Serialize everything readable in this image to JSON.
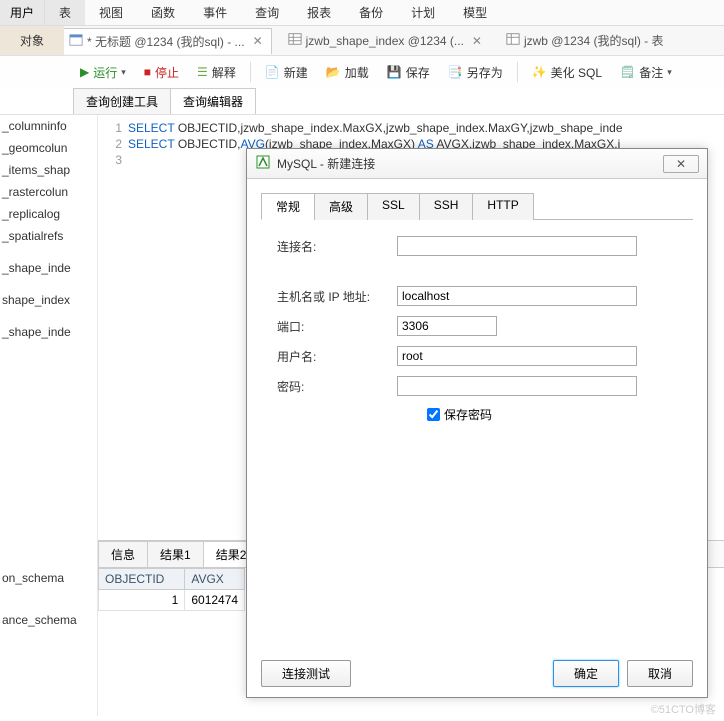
{
  "menubar": {
    "items": [
      "用户",
      "表",
      "视图",
      "函数",
      "事件",
      "查询",
      "报表",
      "备份",
      "计划",
      "模型"
    ],
    "active_index": 1
  },
  "top_tabs": {
    "left_label": "对象",
    "tabs": [
      {
        "icon": "sql",
        "label": "* 无标题 @1234 (我的sql) - ...",
        "closable": true,
        "active": true
      },
      {
        "icon": "table",
        "label": "jzwb_shape_index @1234 (...",
        "closable": true
      },
      {
        "icon": "table",
        "label": "jzwb @1234 (我的sql) - 表",
        "closable": false
      }
    ]
  },
  "toolbar": {
    "run": "运行",
    "stop": "停止",
    "explain": "解释",
    "new": "新建",
    "load": "加载",
    "save": "保存",
    "saveas": "另存为",
    "beautify": "美化 SQL",
    "notes": "备注"
  },
  "subtabs": {
    "items": [
      "查询创建工具",
      "查询编辑器"
    ],
    "active_index": 1
  },
  "sidebar": {
    "top": [
      "_columninfo",
      "_geomcolun",
      "_items_shap",
      "_rastercolun",
      "_replicalog",
      "_spatialrefs",
      "_shape_inde",
      "shape_index",
      "_shape_inde"
    ],
    "bottom": [
      "on_schema",
      "ance_schema"
    ]
  },
  "code": {
    "lines": [
      [
        {
          "t": "SELECT ",
          "k": true
        },
        {
          "t": "OBJECTID,jzwb_shape_index.MaxGX,jzwb_shape_index.MaxGY,jzwb_shape_inde"
        }
      ],
      [
        {
          "t": "SELECT ",
          "k": true
        },
        {
          "t": "OBJECTID,"
        },
        {
          "t": "AVG",
          "k": true
        },
        {
          "t": "(jzwb_shape_index.MaxGX) "
        },
        {
          "t": "AS ",
          "k": true
        },
        {
          "t": "AVGX,jzwb_shape_index.MaxGX,j"
        }
      ],
      []
    ]
  },
  "results": {
    "tabs": [
      "信息",
      "结果1",
      "结果2"
    ],
    "active_index": 2,
    "columns": [
      "OBJECTID",
      "AVGX"
    ],
    "row": [
      "1",
      "6012474"
    ]
  },
  "dialog": {
    "title": "MySQL - 新建连接",
    "close": "✕",
    "tabs": [
      "常规",
      "高级",
      "SSL",
      "SSH",
      "HTTP"
    ],
    "active_index": 0,
    "fields": {
      "conn_name_label": "连接名:",
      "conn_name": "",
      "host_label": "主机名或 IP 地址:",
      "host": "localhost",
      "port_label": "端口:",
      "port": "3306",
      "user_label": "用户名:",
      "user": "root",
      "pass_label": "密码:",
      "pass": "",
      "savepw_label": "保存密码",
      "savepw": true
    },
    "buttons": {
      "test": "连接测试",
      "ok": "确定",
      "cancel": "取消"
    }
  },
  "watermark": "©51CTO博客"
}
